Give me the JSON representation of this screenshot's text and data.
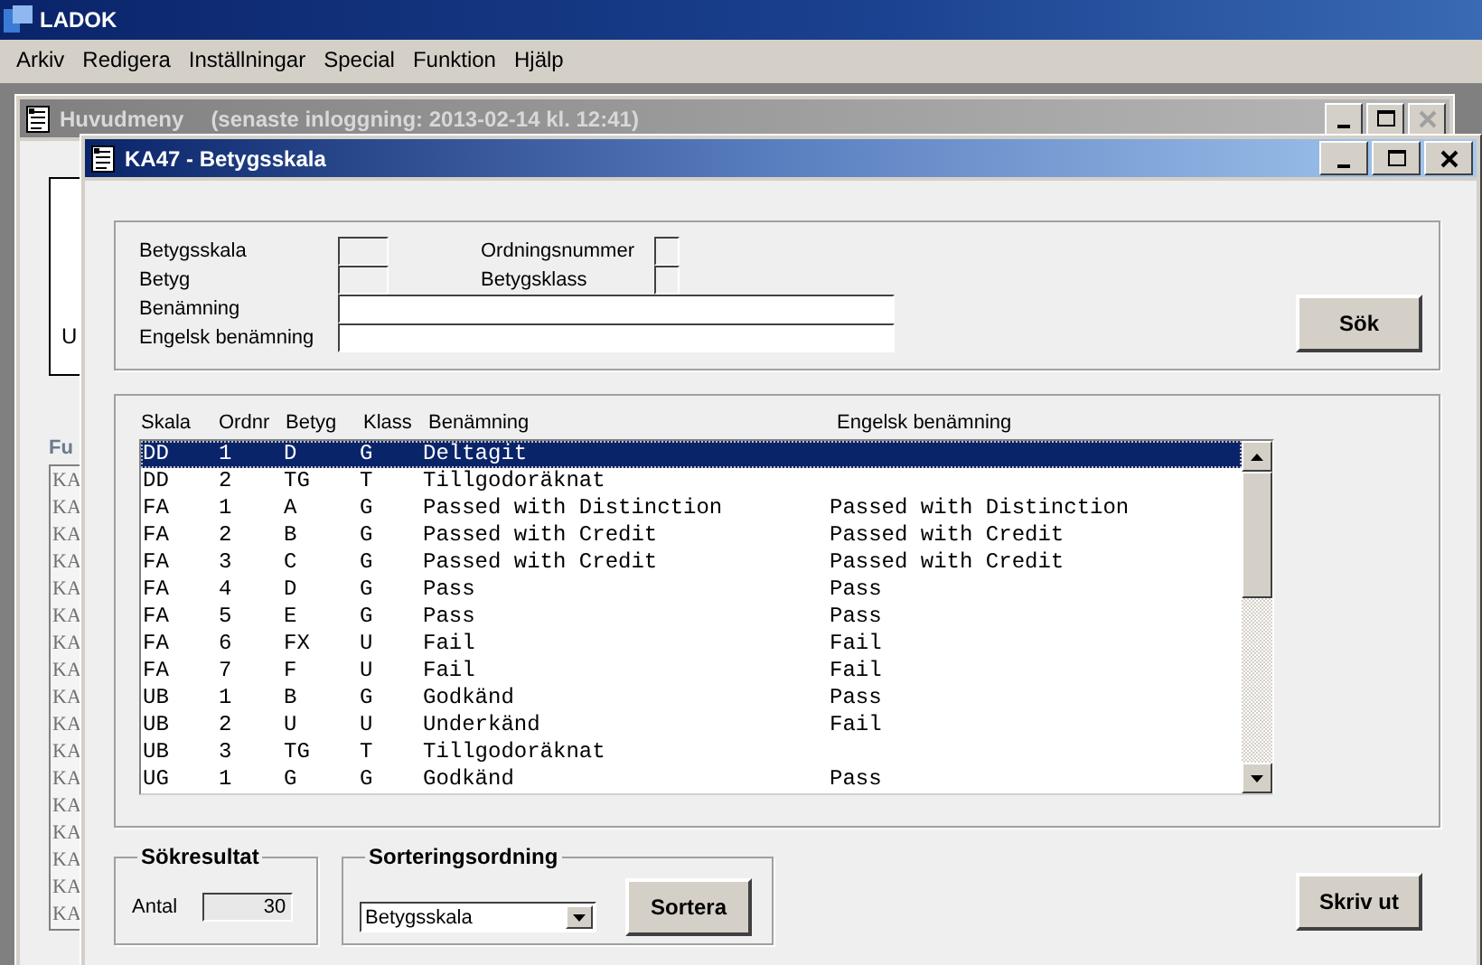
{
  "app": {
    "title": "LADOK",
    "menu": [
      "Arkiv",
      "Redigera",
      "Inställningar",
      "Special",
      "Funktion",
      "Hjälp"
    ]
  },
  "background_window": {
    "title": "Huvudmeny",
    "last_login": "(senaste inloggning: 2013-02-14 kl. 12:41)",
    "panel_label": "U",
    "function_heading": "Fu",
    "function_items": [
      "KA",
      "KA",
      "KA",
      "KA",
      "KA",
      "KA",
      "KA",
      "KA",
      "KA",
      "KA",
      "KA",
      "KA",
      "KA",
      "KA",
      "KA",
      "KA",
      "KA"
    ]
  },
  "dialog": {
    "title": "KA47 - Betygsskala",
    "search_fields": [
      {
        "label": "Betygsskala",
        "kind": "short"
      },
      {
        "label": "Ordningsnummer",
        "kind": "tiny"
      },
      {
        "label": "Betyg",
        "kind": "short"
      },
      {
        "label": "Betygsklass",
        "kind": "tiny"
      },
      {
        "label": "Benämning",
        "kind": "wide"
      },
      {
        "label": "Engelsk benämning",
        "kind": "wide"
      }
    ],
    "search_button": "Sök",
    "columns": [
      "Skala",
      "Ordnr",
      "Betyg",
      "Klass",
      "Benämning",
      "Engelsk benämning"
    ],
    "rows": [
      {
        "cells": [
          "DD",
          "1",
          "D",
          "G",
          "Deltagit",
          ""
        ],
        "selected": true
      },
      {
        "cells": [
          "DD",
          "2",
          "TG",
          "T",
          "Tillgodoräknat",
          ""
        ],
        "selected": false
      },
      {
        "cells": [
          "FA",
          "1",
          "A",
          "G",
          "Passed with Distinction",
          "Passed with Distinction"
        ],
        "selected": false
      },
      {
        "cells": [
          "FA",
          "2",
          "B",
          "G",
          "Passed with Credit",
          "Passed with Credit"
        ],
        "selected": false
      },
      {
        "cells": [
          "FA",
          "3",
          "C",
          "G",
          "Passed with Credit",
          "Passed with Credit"
        ],
        "selected": false
      },
      {
        "cells": [
          "FA",
          "4",
          "D",
          "G",
          "Pass",
          "Pass"
        ],
        "selected": false
      },
      {
        "cells": [
          "FA",
          "5",
          "E",
          "G",
          "Pass",
          "Pass"
        ],
        "selected": false
      },
      {
        "cells": [
          "FA",
          "6",
          "FX",
          "U",
          "Fail",
          "Fail"
        ],
        "selected": false
      },
      {
        "cells": [
          "FA",
          "7",
          "F",
          "U",
          "Fail",
          "Fail"
        ],
        "selected": false
      },
      {
        "cells": [
          "UB",
          "1",
          "B",
          "G",
          "Godkänd",
          "Pass"
        ],
        "selected": false
      },
      {
        "cells": [
          "UB",
          "2",
          "U",
          "U",
          "Underkänd",
          "Fail"
        ],
        "selected": false
      },
      {
        "cells": [
          "UB",
          "3",
          "TG",
          "T",
          "Tillgodoräknat",
          ""
        ],
        "selected": false
      },
      {
        "cells": [
          "UG",
          "1",
          "G",
          "G",
          "Godkänd",
          "Pass"
        ],
        "selected": false
      }
    ],
    "result": {
      "title": "Sökresultat",
      "label": "Antal",
      "value": "30"
    },
    "sorting": {
      "title": "Sorteringsordning",
      "value": "Betygsskala",
      "button": "Sortera"
    },
    "print_button": "Skriv ut"
  }
}
